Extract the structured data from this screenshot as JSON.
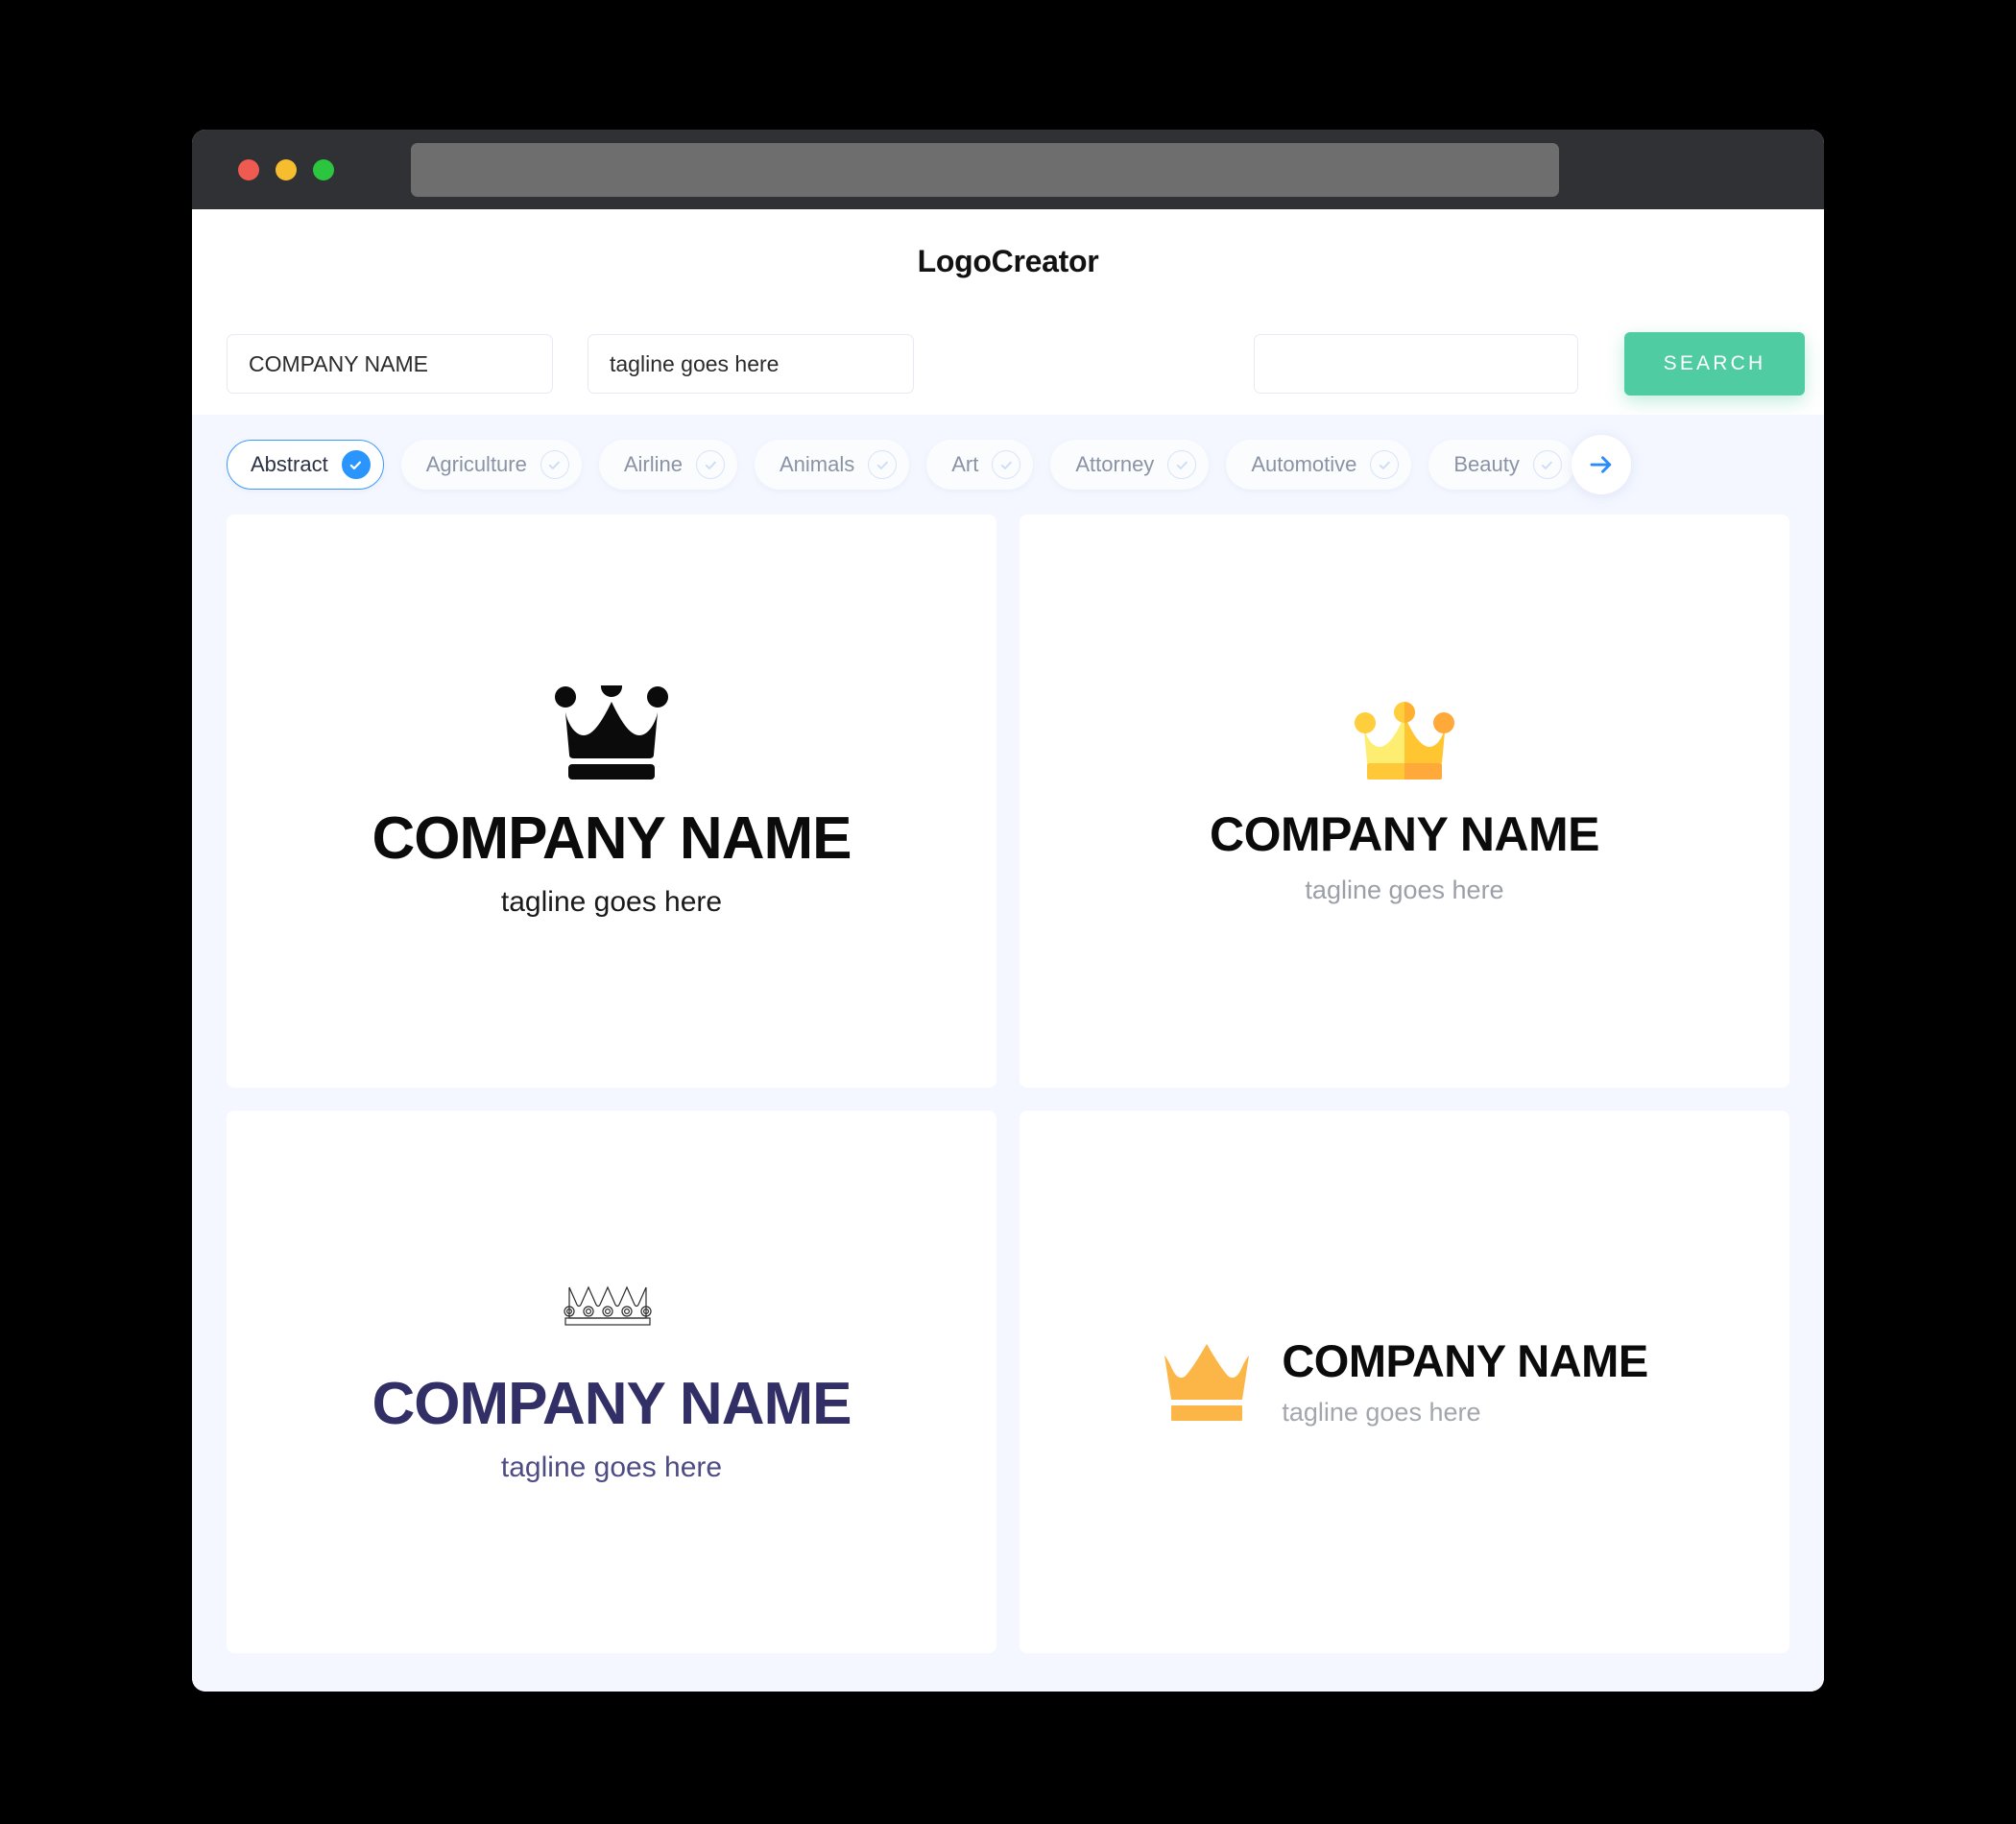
{
  "window": {
    "traffic_lights": [
      {
        "name": "close",
        "color": "#EF5B51"
      },
      {
        "name": "minimize",
        "color": "#F6BD2E"
      },
      {
        "name": "maximize",
        "color": "#2BC540"
      }
    ],
    "url_value": ""
  },
  "header": {
    "title": "LogoCreator"
  },
  "search": {
    "company_value": "COMPANY NAME",
    "company_placeholder": "COMPANY NAME",
    "tagline_value": "tagline goes here",
    "tagline_placeholder": "tagline goes here",
    "extra_value": "",
    "extra_placeholder": "",
    "button_label": "SEARCH",
    "button_color": "#4FCCA1"
  },
  "categories": {
    "selected": "Abstract",
    "next_icon": "arrow-right-icon",
    "accent_color": "#2A95FC",
    "items": [
      {
        "label": "Abstract",
        "selected": true
      },
      {
        "label": "Agriculture",
        "selected": false
      },
      {
        "label": "Airline",
        "selected": false
      },
      {
        "label": "Animals",
        "selected": false
      },
      {
        "label": "Art",
        "selected": false
      },
      {
        "label": "Attorney",
        "selected": false
      },
      {
        "label": "Automotive",
        "selected": false
      },
      {
        "label": "Beauty",
        "selected": false
      }
    ]
  },
  "results": {
    "logos": [
      {
        "id": "logo-1",
        "icon": "crown-icon",
        "icon_style": "solid-black-ball-tipped",
        "icon_colors": [
          "#0B0B0B"
        ],
        "layout": "stacked",
        "company": "COMPANY NAME",
        "tagline": "tagline goes here",
        "company_color": "#0B0B0B",
        "tagline_color": "#1A1A1A"
      },
      {
        "id": "logo-2",
        "icon": "crown-icon",
        "icon_style": "two-tone-yellow-ball-tipped",
        "icon_colors": [
          "#FCE96B",
          "#FFC42E",
          "#FFB23C",
          "#FFA93B"
        ],
        "layout": "stacked",
        "company": "COMPANY NAME",
        "tagline": "tagline goes here",
        "company_color": "#0B0B0B",
        "tagline_color": "#9BA0A8"
      },
      {
        "id": "logo-3",
        "icon": "crown-icon",
        "icon_style": "outline-jeweled",
        "icon_colors": [
          "#2B2B2B"
        ],
        "layout": "stacked",
        "company": "COMPANY NAME",
        "tagline": "tagline goes here",
        "company_color": "#322F66",
        "tagline_color": "#4D4C85"
      },
      {
        "id": "logo-4",
        "icon": "crown-icon",
        "icon_style": "solid-amber-pointed",
        "icon_colors": [
          "#FCB647"
        ],
        "layout": "horizontal",
        "company": "COMPANY NAME",
        "tagline": "tagline goes here",
        "company_color": "#0B0B0B",
        "tagline_color": "#A2A6AD"
      }
    ]
  }
}
